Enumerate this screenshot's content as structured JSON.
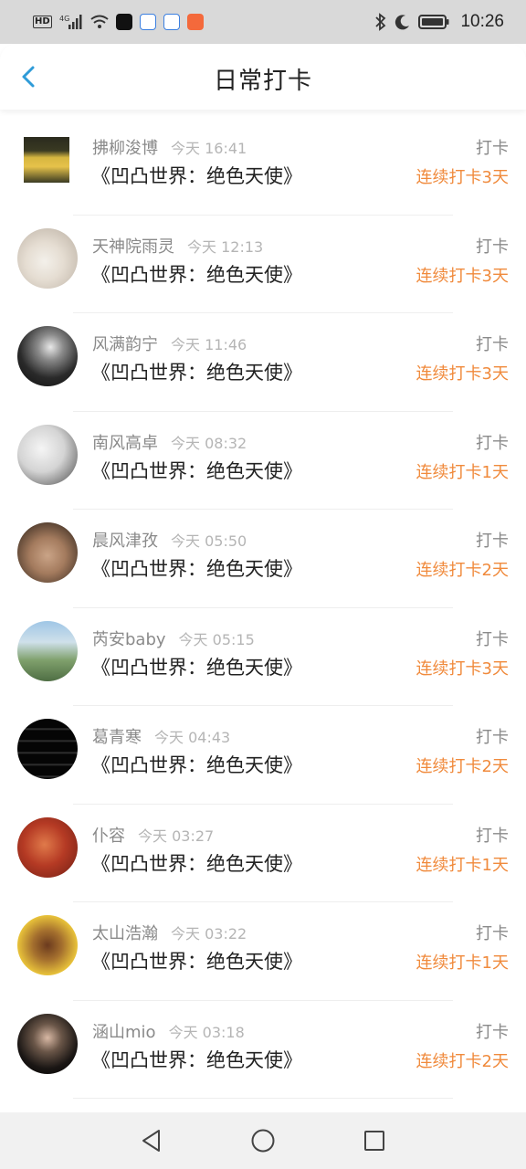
{
  "status_bar": {
    "time": "10:26",
    "left_icons": [
      "hd-icon",
      "4g-signal-icon",
      "wifi-icon",
      "app-notification-icon",
      "baidu-icon",
      "baidu-icon",
      "app-icon"
    ],
    "right_icons": [
      "bluetooth-icon",
      "moon-icon",
      "battery-icon"
    ]
  },
  "header": {
    "title": "日常打卡"
  },
  "entries": [
    {
      "name": "拂柳浚博",
      "time": "今天 16:41",
      "book": "《凹凸世界：绝色天使》",
      "action": "打卡",
      "streak": "连续打卡3天"
    },
    {
      "name": "天神院雨灵",
      "time": "今天 12:13",
      "book": "《凹凸世界：绝色天使》",
      "action": "打卡",
      "streak": "连续打卡3天"
    },
    {
      "name": "风满韵宁",
      "time": "今天 11:46",
      "book": "《凹凸世界：绝色天使》",
      "action": "打卡",
      "streak": "连续打卡3天"
    },
    {
      "name": "南风高卓",
      "time": "今天 08:32",
      "book": "《凹凸世界：绝色天使》",
      "action": "打卡",
      "streak": "连续打卡1天"
    },
    {
      "name": "晨风津孜",
      "time": "今天 05:50",
      "book": "《凹凸世界：绝色天使》",
      "action": "打卡",
      "streak": "连续打卡2天"
    },
    {
      "name": "芮安baby",
      "time": "今天 05:15",
      "book": "《凹凸世界：绝色天使》",
      "action": "打卡",
      "streak": "连续打卡3天"
    },
    {
      "name": "葛青寒",
      "time": "今天 04:43",
      "book": "《凹凸世界：绝色天使》",
      "action": "打卡",
      "streak": "连续打卡2天"
    },
    {
      "name": "仆容",
      "time": "今天 03:27",
      "book": "《凹凸世界：绝色天使》",
      "action": "打卡",
      "streak": "连续打卡1天"
    },
    {
      "name": "太山浩瀚",
      "time": "今天 03:22",
      "book": "《凹凸世界：绝色天使》",
      "action": "打卡",
      "streak": "连续打卡1天"
    },
    {
      "name": "涵山mio",
      "time": "今天 03:18",
      "book": "《凹凸世界：绝色天使》",
      "action": "打卡",
      "streak": "连续打卡2天"
    }
  ],
  "colors": {
    "accent": "#2f9bd8",
    "streak": "#f08a3c",
    "muted": "#8a8a8a"
  },
  "nav": [
    "back-triangle-icon",
    "home-circle-icon",
    "recents-square-icon"
  ]
}
